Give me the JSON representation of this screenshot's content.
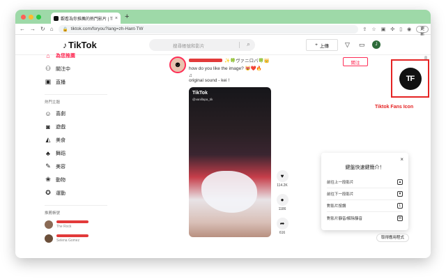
{
  "browser": {
    "tab_title": "觀看為你推薦的熱門影片 | TikTok",
    "tab_close": "×",
    "new_tab": "+",
    "url": "tiktok.com/foryou?lang=zh-Hant-TW",
    "update_label": "更新",
    "colors": {
      "tabstrip": "#9ed9a8",
      "close": "#ff5f57",
      "min": "#febc2e",
      "max": "#28c840"
    }
  },
  "header": {
    "logo_text": "TikTok",
    "search_placeholder": "搜尋帳號和影片",
    "upload_label": "上傳",
    "avatar_initial": "J"
  },
  "sidebar": {
    "nav": [
      {
        "label": "為您推薦",
        "icon": "home-icon",
        "active": true
      },
      {
        "label": "關注中",
        "icon": "users-icon"
      },
      {
        "label": "直播",
        "icon": "live-icon"
      }
    ],
    "topics_title": "熱門主題",
    "topics": [
      {
        "label": "喜劇",
        "icon": "smile-icon"
      },
      {
        "label": "遊戲",
        "icon": "gamepad-icon"
      },
      {
        "label": "美食",
        "icon": "food-icon"
      },
      {
        "label": "舞蹈",
        "icon": "dance-icon"
      },
      {
        "label": "美容",
        "icon": "beauty-icon"
      },
      {
        "label": "動物",
        "icon": "paw-icon"
      },
      {
        "label": "運動",
        "icon": "medal-icon"
      }
    ],
    "accounts_title": "推薦帳號",
    "accounts": [
      {
        "sub": "The Rock"
      },
      {
        "sub": "Selena Gomez"
      }
    ]
  },
  "post": {
    "username_suffix": "✨🍀ヴァニロバ🍀👑",
    "caption": "how do you like the image? 😻❤️🔥",
    "sound_icon": "♫",
    "sound": "original sound - kei !",
    "follow_label": "關注",
    "video_watermark": "TikTok",
    "video_watermark_id": "@vanillapa_tik",
    "likes": "114.2K",
    "comments": "1186",
    "shares": "616"
  },
  "shortcuts": {
    "title": "鍵盤快速鍵簡介！",
    "close": "×",
    "rows": [
      {
        "label": "前往上一段影片",
        "key": "▲"
      },
      {
        "label": "前往下一段影片",
        "key": "▼"
      },
      {
        "label": "對影片按讚",
        "key": "L"
      },
      {
        "label": "對影片靜音/解除靜音",
        "key": "M"
      }
    ]
  },
  "get_app": "取得應用程式",
  "annotation": {
    "logo_text": "TF",
    "label": "Tiktok Fans Icon"
  }
}
